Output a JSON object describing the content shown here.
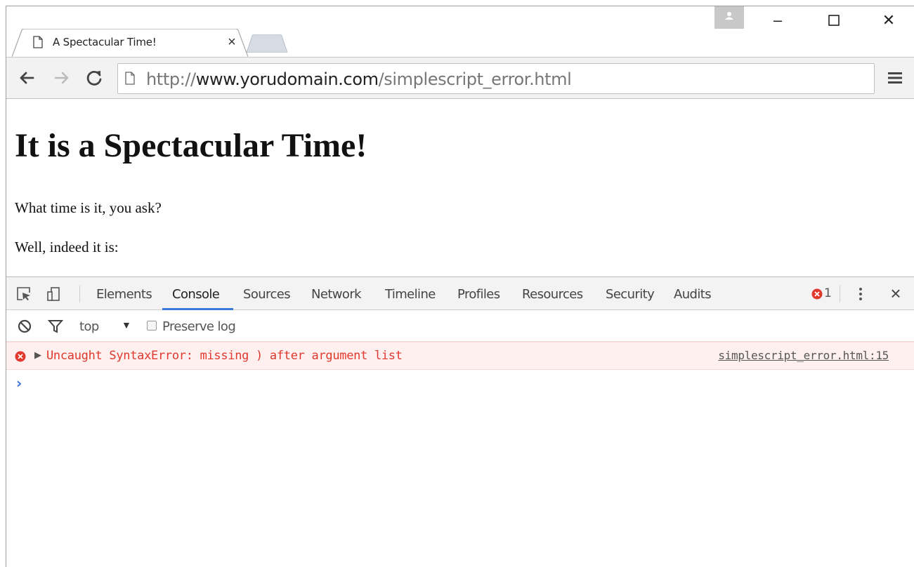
{
  "tab": {
    "title": "A Spectacular Time!",
    "close_glyph": "×"
  },
  "window_controls": {
    "minimize": "–",
    "maximize": "☐",
    "close": "✕"
  },
  "toolbar": {
    "url": {
      "scheme": "http://",
      "host": "www.yorudomain.com",
      "path": "/simplescript_error.html"
    }
  },
  "page": {
    "heading": "It is a Spectacular Time!",
    "paragraphs": [
      "What time is it, you ask?",
      "Well, indeed it is:"
    ]
  },
  "devtools": {
    "tabs": [
      "Elements",
      "Console",
      "Sources",
      "Network",
      "Timeline",
      "Profiles",
      "Resources",
      "Security",
      "Audits"
    ],
    "active_tab": "Console",
    "error_count": "1",
    "close_glyph": "×",
    "filter": {
      "context": "top",
      "context_arrow": "▼",
      "preserve_log_label": "Preserve log"
    },
    "console": {
      "error_message": "Uncaught SyntaxError: missing ) after argument list",
      "error_source": "simplescript_error.html:15",
      "expand_glyph": "▶",
      "prompt": "›"
    }
  },
  "colors": {
    "accent": "#3879d9",
    "error_text": "#e0382d",
    "error_bg": "#fff0f0"
  }
}
